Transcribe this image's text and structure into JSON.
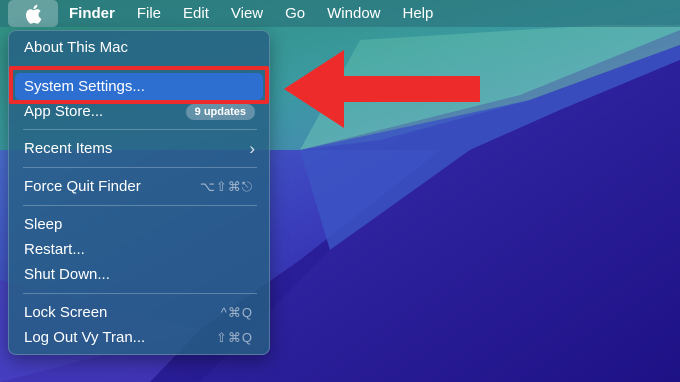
{
  "menubar": {
    "apple_icon": "apple-logo-icon",
    "items": [
      "Finder",
      "File",
      "Edit",
      "View",
      "Go",
      "Window",
      "Help"
    ]
  },
  "apple_menu": {
    "about": "About This Mac",
    "system_settings": "System Settings...",
    "app_store": "App Store...",
    "app_store_badge": "9 updates",
    "recent_items": "Recent Items",
    "recent_items_chevron": "›",
    "force_quit": "Force Quit Finder",
    "force_quit_shortcut": "⌥⇧⌘⎋",
    "sleep": "Sleep",
    "restart": "Restart...",
    "shut_down": "Shut Down...",
    "lock_screen": "Lock Screen",
    "lock_screen_shortcut": "^⌘Q",
    "log_out": "Log Out Vy Tran...",
    "log_out_shortcut": "⇧⌘Q"
  },
  "annotation": {
    "highlight_color": "#ee2b2b",
    "arrow_direction": "left"
  },
  "colors": {
    "selection": "#2d6fd0",
    "menu_background": "#265f82"
  }
}
